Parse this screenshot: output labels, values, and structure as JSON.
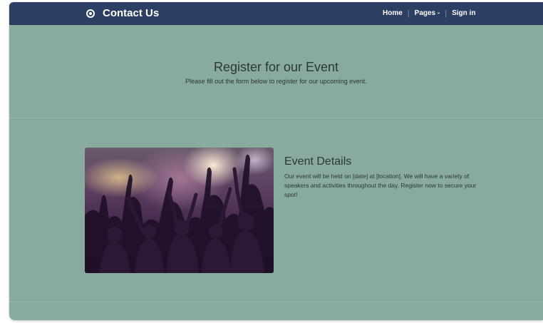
{
  "navbar": {
    "brand": "Contact Us",
    "brand_icon": "radio-button-icon",
    "links": [
      "Home",
      "Pages",
      "Sign in"
    ],
    "pages_caret": "-",
    "separator": "|"
  },
  "hero": {
    "title": "Register for our Event",
    "subtitle": "Please fill out the form below to register for our upcoming event."
  },
  "event": {
    "image_alt": "concert-crowd-photo",
    "title": "Event Details",
    "description": "Our event will be held on [date] at [location]. We will have a variety of speakers and activities throughout the day. Register now to secure your spot!"
  },
  "colors": {
    "navbar_bg": "#2d3e63",
    "page_bg": "#88aa9f",
    "text": "#2e3638"
  }
}
